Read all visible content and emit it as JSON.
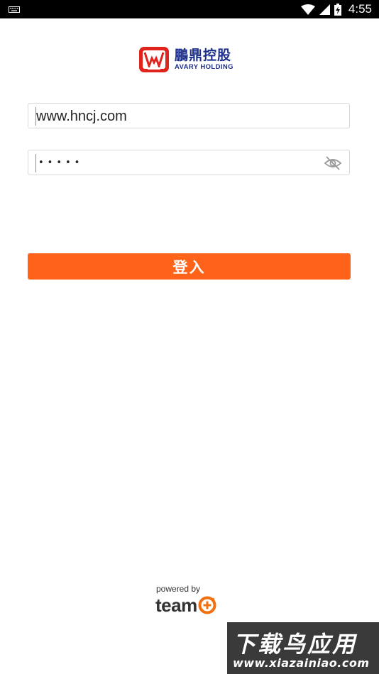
{
  "status_bar": {
    "time": "4:55",
    "icons": [
      "keyboard-icon",
      "wifi-icon",
      "signal-icon",
      "battery-charging-icon"
    ]
  },
  "logo": {
    "chinese_name": "鵬鼎控股",
    "english_name": "AVARY HOLDING",
    "brand_color": "#1d2f8c",
    "mark_color": "#e0231c"
  },
  "login_form": {
    "username_value": "www.hncj.com",
    "password_masked": "•••••",
    "password_visibility_icon": "eye-off-icon",
    "submit_label": "登入",
    "accent_color": "#fe6319"
  },
  "footer": {
    "powered_by": "powered by",
    "brand_word": "team",
    "brand_icon": "teamo-o-icon"
  },
  "watermark": {
    "chinese_text": "下载鸟应用",
    "url_text": "www.xiazainiao.com"
  }
}
